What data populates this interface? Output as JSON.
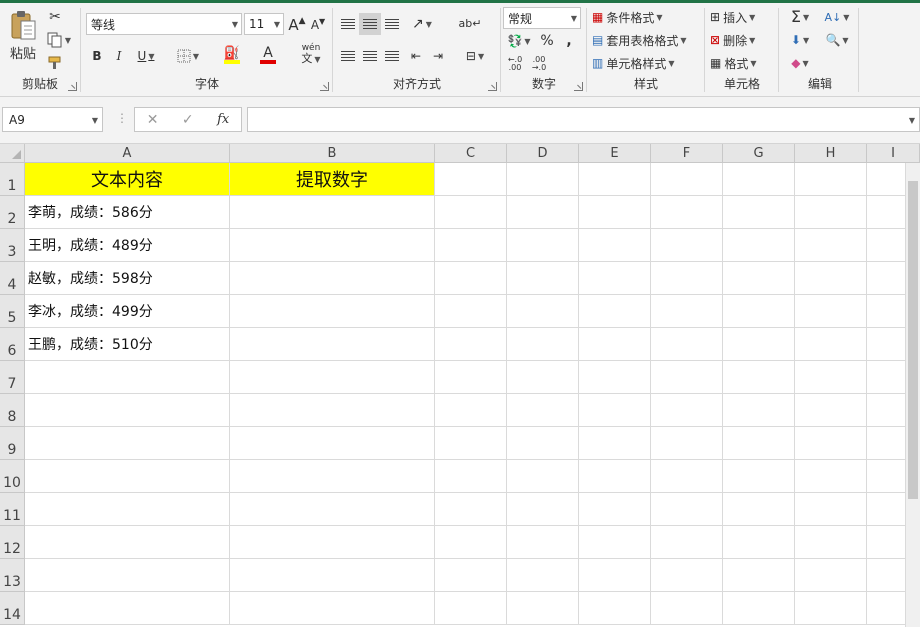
{
  "ribbon": {
    "clipboard": {
      "label": "剪贴板",
      "paste_label": "粘贴"
    },
    "font": {
      "label": "字体",
      "font_name": "等线",
      "font_size": "11",
      "bold": "B",
      "italic": "I",
      "underline": "U",
      "phonetic": "wén",
      "font_color_glyph": "A",
      "increase_font": "A",
      "decrease_font": "A"
    },
    "alignment": {
      "label": "对齐方式"
    },
    "number": {
      "label": "数字",
      "format": "常规",
      "percent": "%",
      "comma": ",",
      "increase_decimal": "←.0\n.00",
      "decrease_decimal": ".00\n→.0"
    },
    "styles": {
      "label": "样式",
      "conditional": "条件格式",
      "table_format": "套用表格格式",
      "cell_styles": "单元格样式"
    },
    "cells": {
      "label": "单元格",
      "insert": "插入",
      "delete": "删除",
      "format": "格式"
    },
    "editing": {
      "label": "编辑"
    }
  },
  "formula_bar": {
    "name_box": "A9",
    "fx": "fx",
    "content": ""
  },
  "grid": {
    "columns": [
      "A",
      "B",
      "C",
      "D",
      "E",
      "F",
      "G",
      "H",
      "I"
    ],
    "rows": [
      "1",
      "2",
      "3",
      "4",
      "5",
      "6",
      "7",
      "8",
      "9",
      "10",
      "11",
      "12",
      "13",
      "14"
    ],
    "headers": {
      "A1": "文本内容",
      "B1": "提取数字"
    },
    "data": [
      "李萌，成绩：586分",
      "王明，成绩：489分",
      "赵敏，成绩：598分",
      "李冰，成绩：499分",
      "王鹏，成绩：510分"
    ]
  },
  "colors": {
    "header_fill": "#ffff00",
    "accent": "#217346",
    "font_color_bar": "#e00000",
    "fill_color_bar": "#ffff00"
  }
}
